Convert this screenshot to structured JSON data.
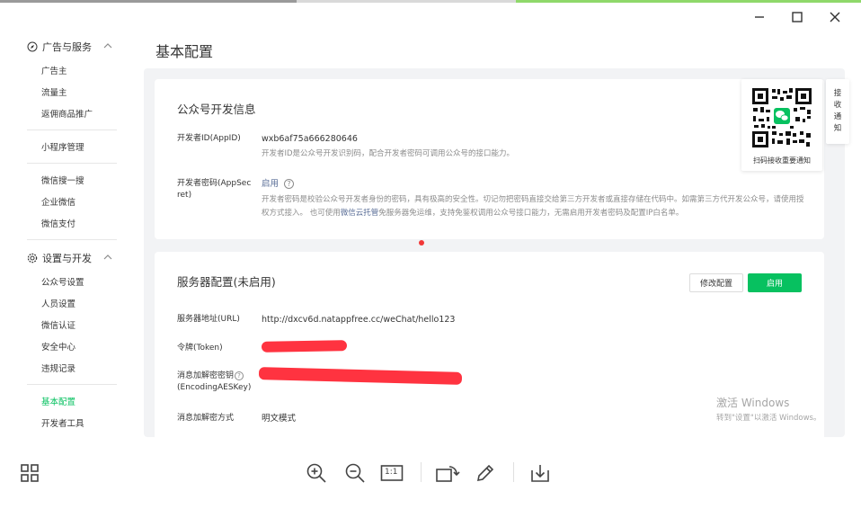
{
  "window": {
    "controls": [
      "minimize",
      "maximize",
      "close"
    ]
  },
  "sidebar": {
    "groups": [
      {
        "label": "广告与服务",
        "icon": "compass-icon",
        "items": [
          "广告主",
          "流量主",
          "返佣商品推广"
        ]
      },
      {
        "label": "",
        "items": [
          "小程序管理"
        ]
      },
      {
        "label": "",
        "items": [
          "微信搜一搜",
          "企业微信",
          "微信支付"
        ]
      },
      {
        "label": "设置与开发",
        "icon": "gear-icon",
        "items": [
          "公众号设置",
          "人员设置",
          "微信认证",
          "安全中心",
          "违规记录"
        ]
      },
      {
        "label": "",
        "items": [
          "基本配置",
          "开发者工具"
        ],
        "active": "基本配置"
      }
    ]
  },
  "page": {
    "title": "基本配置"
  },
  "dev_info": {
    "title": "公众号开发信息",
    "appid_label": "开发者ID(AppID)",
    "appid_value": "wxb6af75a666280646",
    "appid_desc": "开发者ID是公众号开发识别码，配合开发者密码可调用公众号的接口能力。",
    "secret_label_1": "开发者密码(AppSec",
    "secret_label_2": "ret)",
    "secret_link": "启用",
    "secret_desc_1": "开发者密码是校验公众号开发者身份的密码，具有极高的安全性。切记勿把密码直接交给第三方开发者或直接存储在代码中。如需第三方代开发公众号，请使用授",
    "secret_desc_2a": "权方式接入。 也可使用",
    "secret_desc_link": "微信云托管",
    "secret_desc_2b": "免服务器免运维，支持免鉴权调用公众号接口能力，无需启用开发者密码及配置IP白名单。"
  },
  "server_config": {
    "title": "服务器配置(未启用)",
    "modify_button": "修改配置",
    "enable_button": "启用",
    "url_label": "服务器地址(URL)",
    "url_value": "http://dxcv6d.natappfree.cc/weChat/hello123",
    "token_label": "令牌(Token)",
    "aes_label_1": "消息加解密密钥",
    "aes_label_2": "(EncodingAESKey)",
    "mode_label": "消息加解密方式",
    "mode_value": "明文模式"
  },
  "qr": {
    "caption": "扫码接收重要通知",
    "side_text": [
      "接",
      "收",
      "通",
      "知"
    ]
  },
  "watermark": {
    "line1": "激活 Windows",
    "line2": "转到\"设置\"以激活 Windows。"
  },
  "toolbar": {
    "tools": [
      "grid-icon",
      "zoom-in-icon",
      "zoom-out-icon",
      "actual-size-icon",
      "rotate-icon",
      "pen-icon",
      "download-icon"
    ],
    "actual_size_label": "1:1"
  },
  "colors": {
    "accent_green": "#07c160",
    "link_blue": "#576b95",
    "redaction_red": "#ff3340",
    "content_bg": "#f2f3f5"
  }
}
